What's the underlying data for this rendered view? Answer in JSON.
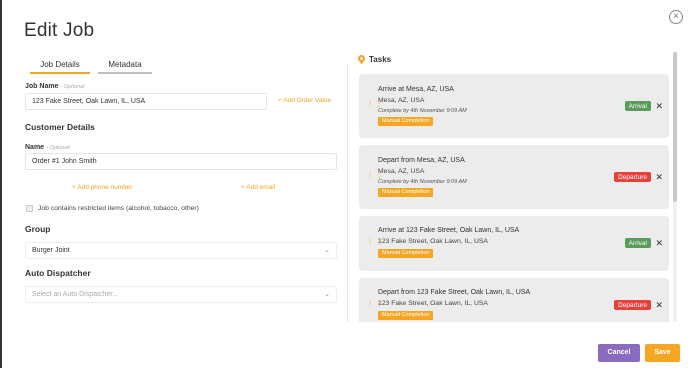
{
  "modal": {
    "title": "Edit Job",
    "close_icon": "close-icon",
    "close_glyph": "×"
  },
  "tabs": [
    {
      "label": "Job Details",
      "active": true
    },
    {
      "label": "Metadata",
      "active": false
    }
  ],
  "job_name": {
    "label": "Job Name",
    "optional": "- Optional",
    "value": "123 Fake Street, Oak Lawn, IL, USA",
    "add_order_value": "+ Add Order Value"
  },
  "customer_details": {
    "heading": "Customer Details",
    "name_label": "Name",
    "name_optional": "- Optional",
    "name_value": "Order #1 John Smith",
    "add_phone": "+ Add phone number",
    "add_email": "+ Add email"
  },
  "restricted": {
    "label": "Job contains restricted items (alcohol, tobacco, other)",
    "checked": false
  },
  "group": {
    "heading": "Group",
    "value": "Burger Joint",
    "chevron_icon": "chevron-down-icon"
  },
  "auto_dispatcher": {
    "heading": "Auto Dispatcher",
    "placeholder": "Select an Auto Dispatcher..."
  },
  "tasks": {
    "title": "Tasks",
    "pin_icon": "map-pin-icon",
    "items": [
      {
        "title": "Arrive at Mesa, AZ, USA",
        "address": "Mesa, AZ, USA",
        "complete_by": "Complete by 4th November 9:09 AM",
        "mode": "Manual Completion",
        "type": "Arrival"
      },
      {
        "title": "Depart from Mesa, AZ, USA",
        "address": "Mesa, AZ, USA",
        "complete_by": "Complete by 4th November 9:09 AM",
        "mode": "Manual Completion",
        "type": "Departure"
      },
      {
        "title": "Arrive at 123 Fake Street, Oak Lawn, IL, USA",
        "address": "123 Fake Street, Oak Lawn, IL, USA",
        "complete_by": "",
        "mode": "Manual Completion",
        "type": "Arrival"
      },
      {
        "title": "Depart from 123 Fake Street, Oak Lawn, IL, USA",
        "address": "123 Fake Street, Oak Lawn, IL, USA",
        "complete_by": "",
        "mode": "Manual Completion",
        "type": "Departure"
      }
    ]
  },
  "footer": {
    "cancel": "Cancel",
    "save": "Save"
  },
  "colors": {
    "accent": "#f5a623",
    "cancel": "#8a6bbf",
    "arrival": "#5a9a5a",
    "departure": "#e8413c"
  }
}
